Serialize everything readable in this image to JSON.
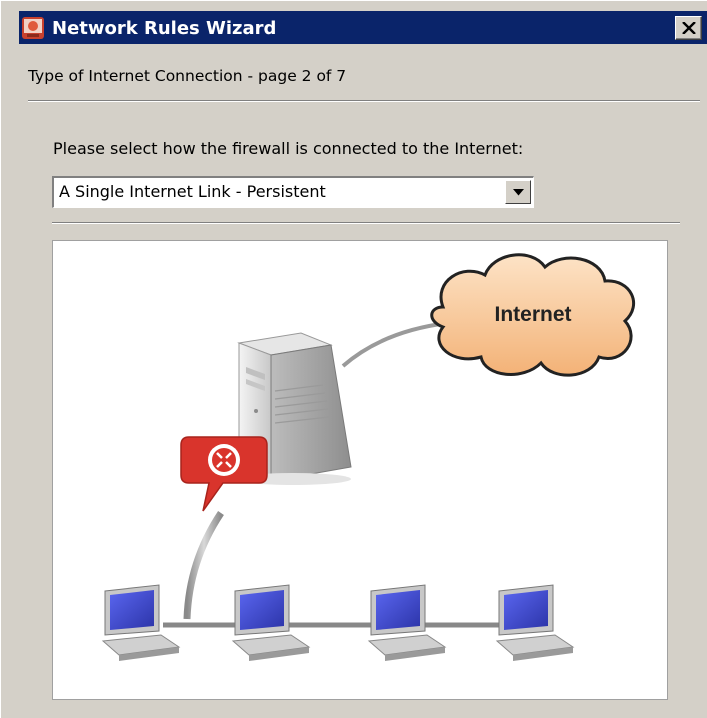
{
  "window": {
    "title": "Network Rules Wizard",
    "icon": "wizard-app-icon",
    "close_icon": "close-icon"
  },
  "page": {
    "heading": "Type of Internet Connection - page 2 of 7",
    "prompt": "Please select how the firewall is connected to the Internet:"
  },
  "connection_select": {
    "selected": "A Single Internet Link - Persistent",
    "arrow_icon": "chevron-down-icon"
  },
  "diagram": {
    "cloud_label": "Internet",
    "client_count": 4
  },
  "colors": {
    "titlebar": "#0a246a",
    "face": "#d4d0c8",
    "cloud_fill": "#f4c698",
    "router_badge": "#d9342c",
    "monitor_screen": "#3b45c8"
  }
}
